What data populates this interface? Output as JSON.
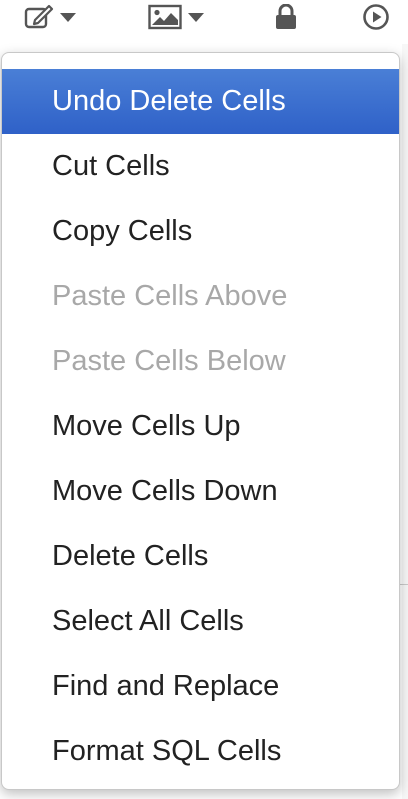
{
  "toolbar": {
    "icons": [
      {
        "name": "edit-icon",
        "has_dropdown": true
      },
      {
        "name": "image-icon",
        "has_dropdown": true
      },
      {
        "name": "lock-icon",
        "has_dropdown": false
      },
      {
        "name": "play-circle-icon",
        "has_dropdown": false
      }
    ],
    "icon_color": "#555555"
  },
  "menu": {
    "active_color": "#3a6fd0",
    "disabled_color": "#a8a8a8",
    "items": [
      {
        "label": "Undo Delete Cells",
        "state": "active"
      },
      {
        "label": "Cut Cells",
        "state": "normal"
      },
      {
        "label": "Copy Cells",
        "state": "normal"
      },
      {
        "label": "Paste Cells Above",
        "state": "disabled"
      },
      {
        "label": "Paste Cells Below",
        "state": "disabled"
      },
      {
        "label": "Move Cells Up",
        "state": "normal"
      },
      {
        "label": "Move Cells Down",
        "state": "normal"
      },
      {
        "label": "Delete Cells",
        "state": "normal"
      },
      {
        "label": "Select All Cells",
        "state": "normal"
      },
      {
        "label": "Find and Replace",
        "state": "normal"
      },
      {
        "label": "Format SQL Cells",
        "state": "normal"
      }
    ]
  }
}
